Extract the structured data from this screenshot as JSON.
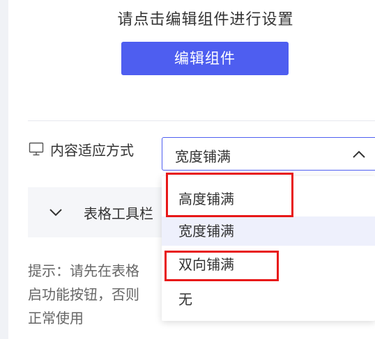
{
  "header": {
    "hint": "请点击编辑组件进行设置",
    "edit_button_label": "编辑组件"
  },
  "fit_mode": {
    "label": "内容适应方式",
    "icon": "monitor-icon",
    "selected_value": "宽度铺满",
    "options": [
      "高度铺满",
      "宽度铺满",
      "双向铺满",
      "无"
    ],
    "selected_index": 1,
    "highlighted_options": [
      "高度铺满",
      "双向铺满"
    ]
  },
  "toolbar_section": {
    "title": "表格工具栏",
    "expanded": false
  },
  "tip": {
    "line1": "提示：请先在表格",
    "line2": "启功能按钮，否则",
    "line3": "正常使用"
  },
  "colors": {
    "primary": "#4e5ef0",
    "highlight_border": "#e81818",
    "selected_option_bg": "#eef0fc"
  }
}
